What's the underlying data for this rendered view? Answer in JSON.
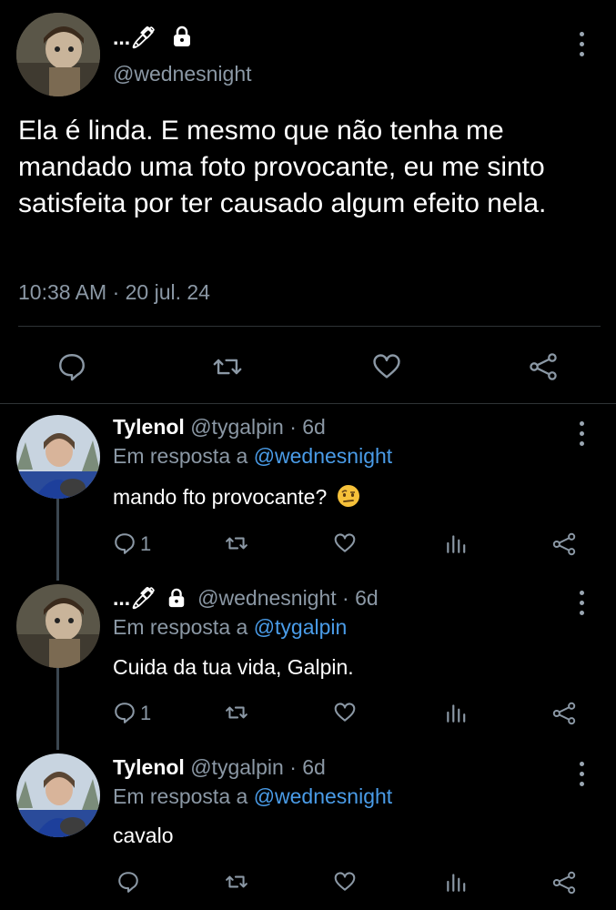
{
  "main_tweet": {
    "display_name": "...🖊",
    "handle": "@wednesnight",
    "text": "Ela é linda. E mesmo que não tenha me mandado uma foto provocante, eu me sinto satisfeita por ter causado algum efeito nela.",
    "timestamp": "10:38 AM · 20 jul. 24"
  },
  "replies": [
    {
      "display_name": "Tylenol",
      "handle_time": "@tygalpin · 6d",
      "reply_prefix": "Em resposta a",
      "reply_to": "@wednesnight",
      "text": "mando fto provocante?",
      "emoji": "🤨",
      "reply_count": "1"
    },
    {
      "display_name": "...🖊",
      "handle_time": "@wednesnight · 6d",
      "reply_prefix": "Em resposta a",
      "reply_to": "@tygalpin",
      "text": "Cuida da tua vida, Galpin.",
      "reply_count": "1"
    },
    {
      "display_name": "Tylenol",
      "handle_time": "@tygalpin · 6d",
      "reply_prefix": "Em resposta a",
      "reply_to": "@wednesnight",
      "text": "cavalo",
      "reply_count": ""
    }
  ],
  "icons": {
    "lock": "lock-icon",
    "more": "more-vertical-icon",
    "reply": "reply-icon",
    "retweet": "retweet-icon",
    "like": "heart-icon",
    "stats": "stats-icon",
    "share": "share-icon"
  },
  "colors": {
    "background": "#000000",
    "link": "#4a9ce8",
    "muted": "#8b98a5"
  }
}
